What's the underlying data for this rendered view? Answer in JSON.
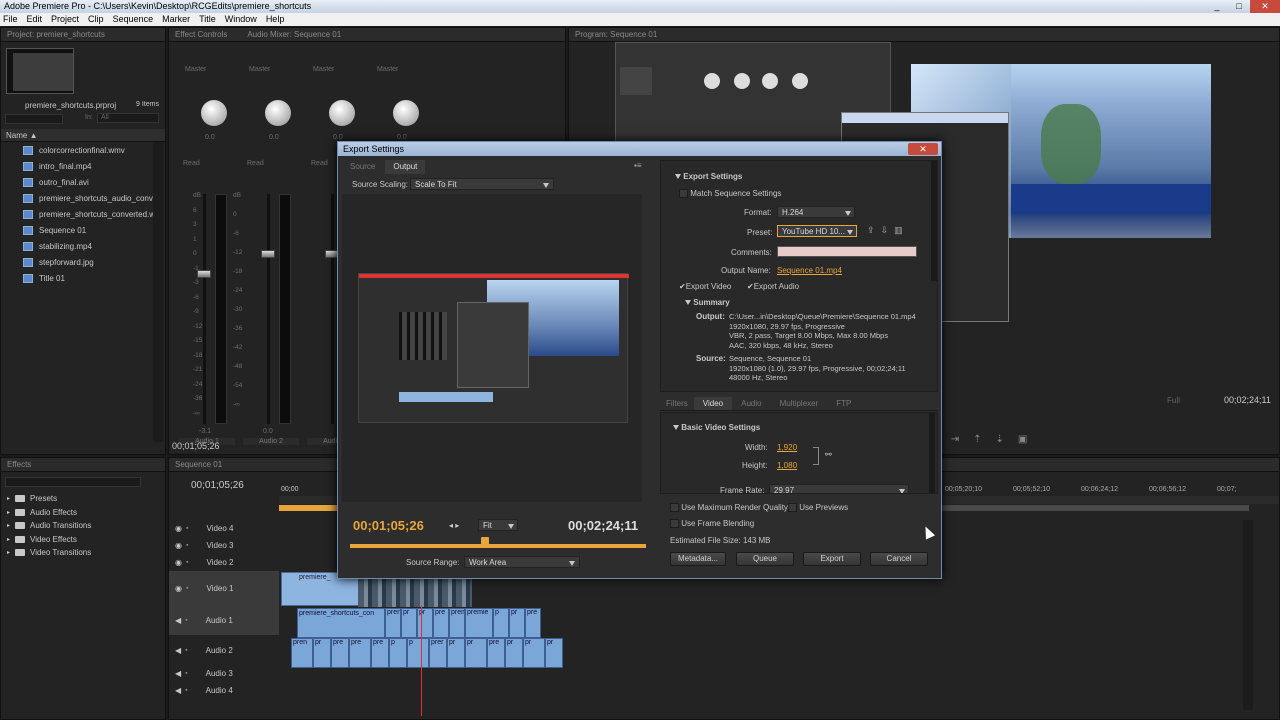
{
  "window": {
    "title": "Adobe Premiere Pro - C:\\Users\\Kevin\\Desktop\\RCGEdits\\premiere_shortcuts",
    "controls": [
      "_",
      "□",
      "✕"
    ]
  },
  "menu": [
    "File",
    "Edit",
    "Project",
    "Clip",
    "Sequence",
    "Marker",
    "Title",
    "Window",
    "Help"
  ],
  "project": {
    "tab": "Project: premiere_shortcuts",
    "filename": "premiere_shortcuts.prproj",
    "count": "9 Items",
    "in_label": "In:",
    "in_value": "All",
    "column_name": "Name",
    "items": [
      {
        "name": "colorcorrectionfinal.wmv",
        "icon": "video-file-icon"
      },
      {
        "name": "intro_final.mp4",
        "icon": "video-file-icon"
      },
      {
        "name": "outro_final.avi",
        "icon": "video-file-icon"
      },
      {
        "name": "premiere_shortcuts_audio_conve",
        "icon": "audio-file-icon"
      },
      {
        "name": "premiere_shortcuts_converted.wi",
        "icon": "video-file-icon"
      },
      {
        "name": "Sequence 01",
        "icon": "sequence-icon"
      },
      {
        "name": "stabilizing.mp4",
        "icon": "video-file-icon"
      },
      {
        "name": "stepforward.jpg",
        "icon": "image-file-icon"
      },
      {
        "name": "Title 01",
        "icon": "title-icon"
      }
    ]
  },
  "mixer": {
    "tabs": [
      "Effect Controls",
      "Audio Mixer: Sequence 01"
    ],
    "channels": [
      {
        "label": "Audio 1",
        "mode": "Read",
        "value": "0.0",
        "peak": "-3.1"
      },
      {
        "label": "Audio 2",
        "mode": "Read",
        "value": "0.0",
        "peak": "0.0"
      },
      {
        "label": "Audio 3",
        "mode": "Read",
        "value": "0.0",
        "peak": ""
      },
      {
        "label": "Master",
        "mode": "Read",
        "value": "0.0",
        "peak": ""
      }
    ],
    "master_label": "Master",
    "scale": [
      "dB",
      "0",
      "-6",
      "-12",
      "-18",
      "-24",
      "-30",
      "-36",
      "-42",
      "-48",
      "-54",
      "-∞"
    ],
    "left_scale": [
      "dB",
      "6",
      "3",
      "1",
      "0",
      "-1",
      "-3",
      "-6",
      "-9",
      "-12",
      "-15",
      "-18",
      "-21",
      "-24",
      "-36",
      "-∞"
    ],
    "timecode": "00;01;05;26"
  },
  "program": {
    "tab": "Program: Sequence 01",
    "zoom": "Full",
    "timecode": "00;02;24;11"
  },
  "effects": {
    "tab": "Effects",
    "items": [
      "Presets",
      "Audio Effects",
      "Audio Transitions",
      "Video Effects",
      "Video Transitions"
    ]
  },
  "timeline": {
    "tab": "Sequence 01",
    "timecode": "00;01;05;26",
    "ruler_left": "00;00",
    "ruler": [
      "00;05;20;10",
      "00;05;52;10",
      "00;06;24;12",
      "00;06;56;12",
      "00;07;"
    ],
    "tracks": [
      {
        "name": "Video 4",
        "type": "video"
      },
      {
        "name": "Video 3",
        "type": "video"
      },
      {
        "name": "Video 2",
        "type": "video"
      },
      {
        "name": "Video 1",
        "type": "video"
      },
      {
        "name": "Audio 1",
        "type": "audio"
      },
      {
        "name": "Audio 2",
        "type": "audio"
      },
      {
        "name": "Audio 3",
        "type": "audio"
      },
      {
        "name": "Audio 4",
        "type": "audio"
      }
    ],
    "clip_video1": "premiere_",
    "clip_audio1": "premiere_shortcuts_con",
    "clip_audio1_small": [
      "pren",
      "pr",
      "pr",
      "pre",
      "prem",
      "premie",
      "p",
      "pr",
      "pre"
    ],
    "clip_audio2_small": [
      "pren",
      "pr",
      "pre",
      "pre",
      "pre",
      "p",
      "p",
      "prer",
      "pr",
      "pr",
      "pre",
      "pr",
      "pr",
      "pr"
    ]
  },
  "export": {
    "title": "Export Settings",
    "close": "✕",
    "tabs": [
      "Source",
      "Output"
    ],
    "active_tab": "Output",
    "source_scaling_label": "Source Scaling:",
    "source_scaling": "Scale To Fit",
    "timecode_in": "00;01;05;26",
    "timecode_out": "00;02;24;11",
    "fit": "Fit",
    "source_range_label": "Source Range:",
    "source_range": "Work Area",
    "settings_header": "Export Settings",
    "match_sequence": "Match Sequence Settings",
    "format_label": "Format:",
    "format": "H.264",
    "preset_label": "Preset:",
    "preset": "YouTube HD 10...",
    "comments_label": "Comments:",
    "output_name_label": "Output Name:",
    "output_name": "Sequence 01.mp4",
    "export_video": "Export Video",
    "export_audio": "Export Audio",
    "summary_header": "Summary",
    "output_label": "Output:",
    "output_lines": [
      "C:\\User...in\\Desktop\\Queue\\Premiere\\Sequence 01.mp4",
      "1920x1080, 29.97 fps, Progressive",
      "VBR, 2 pass, Target 8.00 Mbps, Max 8.00 Mbps",
      "AAC, 320 kbps, 48 kHz, Stereo"
    ],
    "source_label": "Source:",
    "source_lines": [
      "Sequence, Sequence 01",
      "1920x1080 (1.0), 29.97 fps, Progressive, 00;02;24;11",
      "48000 Hz, Stereo"
    ],
    "settings_tabs": [
      "Filters",
      "Video",
      "Audio",
      "Multiplexer",
      "FTP"
    ],
    "active_settings_tab": "Video",
    "basic_video": "Basic Video Settings",
    "width_label": "Width:",
    "width": "1,920",
    "height_label": "Height:",
    "height": "1,080",
    "frame_rate_label": "Frame Rate:",
    "frame_rate": "29.97",
    "max_render": "Use Maximum Render Quality",
    "use_previews": "Use Previews",
    "frame_blending": "Use Frame Blending",
    "file_size_label": "Estimated File Size:",
    "file_size": "143 MB",
    "buttons": {
      "metadata": "Metadata...",
      "queue": "Queue",
      "export": "Export",
      "cancel": "Cancel"
    }
  },
  "colors": {
    "accent_orange": "#e8a53a",
    "clip_blue": "#8eb4e0",
    "title_blue": "#b9cde6",
    "close_red": "#c74b3c"
  }
}
